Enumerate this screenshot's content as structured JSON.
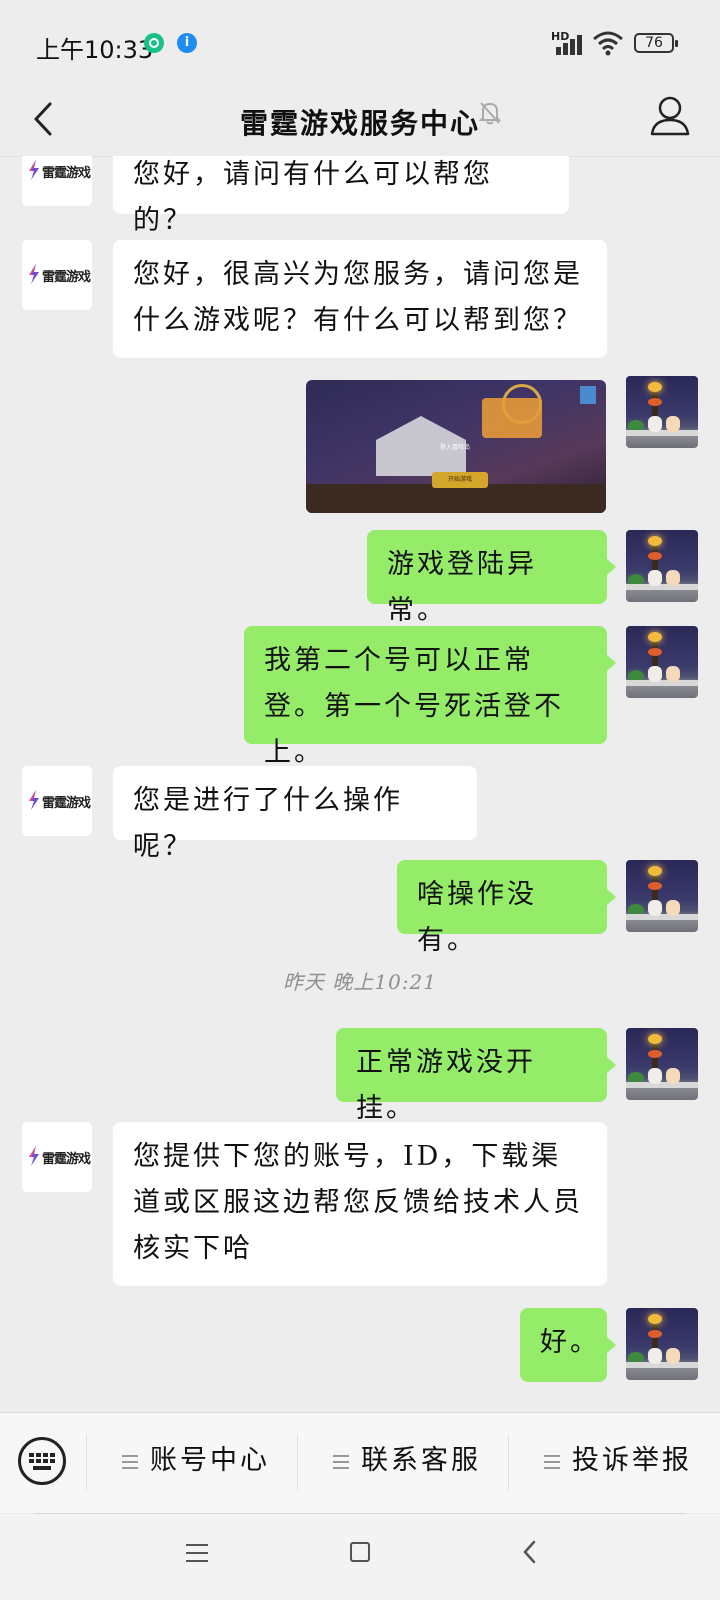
{
  "status_bar": {
    "time": "上午10:33",
    "network_label": "HD",
    "battery": "76"
  },
  "header": {
    "title": "雷霆游戏服务中心"
  },
  "bot": {
    "logo_text": "雷霆游戏"
  },
  "messages": [
    {
      "side": "left",
      "text": "您好，请问有什么可以帮您的？"
    },
    {
      "side": "left",
      "text": "您好，很高兴为您服务，请问您是什么游戏呢？有什么可以帮到您？"
    },
    {
      "side": "right",
      "type": "image",
      "text": "登入冒险岛",
      "button": "开始游戏"
    },
    {
      "side": "right",
      "text": "游戏登陆异常。"
    },
    {
      "side": "right",
      "text": "我第二个号可以正常登。第一个号死活登不上。"
    },
    {
      "side": "left",
      "text": "您是进行了什么操作呢？"
    },
    {
      "side": "right",
      "text": "啥操作没有。"
    },
    {
      "side": "right",
      "text": "正常游戏没开挂。"
    },
    {
      "side": "left",
      "text": "您提供下您的账号，ID，下载渠道或区服这边帮您反馈给技术人员核实下哈"
    },
    {
      "side": "right",
      "text": "好。"
    }
  ],
  "timestamp": "昨天 晚上10:21",
  "bottom_menu": {
    "items": [
      "账号中心",
      "联系客服",
      "投诉举报"
    ]
  },
  "colors": {
    "background": "#ededed",
    "bubble_right": "#95ec69",
    "bubble_left": "#ffffff"
  }
}
